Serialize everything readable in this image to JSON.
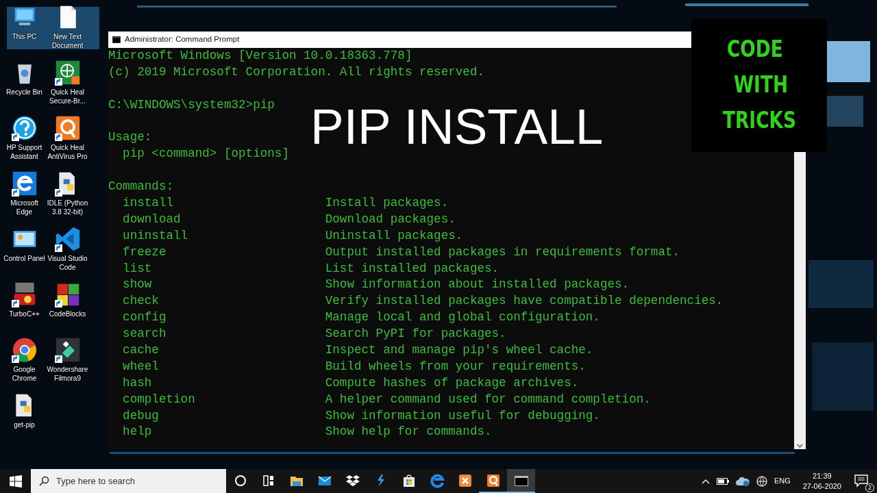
{
  "desktop_icons": [
    {
      "label": "This PC",
      "kind": "thispc",
      "shortcut": false
    },
    {
      "label": "New Text Document",
      "kind": "textdoc",
      "shortcut": false
    },
    {
      "label": "Recycle Bin",
      "kind": "recycle",
      "shortcut": false
    },
    {
      "label": "Quick Heal Secure-Br...",
      "kind": "qhbrowser",
      "shortcut": true
    },
    {
      "label": "HP Support Assistant",
      "kind": "hp",
      "shortcut": true
    },
    {
      "label": "Quick Heal AntiVirus Pro",
      "kind": "quickheal",
      "shortcut": true
    },
    {
      "label": "Microsoft Edge",
      "kind": "edge",
      "shortcut": true
    },
    {
      "label": "IDLE (Python 3.8 32-bit)",
      "kind": "python",
      "shortcut": true
    },
    {
      "label": "Control Panel",
      "kind": "controlpanel",
      "shortcut": false
    },
    {
      "label": "Visual Studio Code",
      "kind": "vscode",
      "shortcut": true
    },
    {
      "label": "TurboC++",
      "kind": "turbo",
      "shortcut": true
    },
    {
      "label": "CodeBlocks",
      "kind": "codeblocks",
      "shortcut": true
    },
    {
      "label": "Google Chrome",
      "kind": "chrome",
      "shortcut": true
    },
    {
      "label": "Wondershare Filmora9",
      "kind": "filmora",
      "shortcut": true
    },
    {
      "label": "get-pip",
      "kind": "python",
      "shortcut": false
    }
  ],
  "window": {
    "title": "Administrator: Command Prompt",
    "banner": [
      "Microsoft Windows [Version 10.0.18363.778]",
      "(c) 2019 Microsoft Corporation. All rights reserved."
    ],
    "prompt": "C:\\WINDOWS\\system32>pip",
    "usage_heading": "Usage:",
    "usage": "pip <command> [options]",
    "commands_heading": "Commands:",
    "commands": [
      {
        "name": "install",
        "description": "Install packages."
      },
      {
        "name": "download",
        "description": "Download packages."
      },
      {
        "name": "uninstall",
        "description": "Uninstall packages."
      },
      {
        "name": "freeze",
        "description": "Output installed packages in requirements format."
      },
      {
        "name": "list",
        "description": "List installed packages."
      },
      {
        "name": "show",
        "description": "Show information about installed packages."
      },
      {
        "name": "check",
        "description": "Verify installed packages have compatible dependencies."
      },
      {
        "name": "config",
        "description": "Manage local and global configuration."
      },
      {
        "name": "search",
        "description": "Search PyPI for packages."
      },
      {
        "name": "cache",
        "description": "Inspect and manage pip's wheel cache."
      },
      {
        "name": "wheel",
        "description": "Build wheels from your requirements."
      },
      {
        "name": "hash",
        "description": "Compute hashes of package archives."
      },
      {
        "name": "completion",
        "description": "A helper command used for command completion."
      },
      {
        "name": "debug",
        "description": "Show information useful for debugging."
      },
      {
        "name": "help",
        "description": "Show help for commands."
      }
    ]
  },
  "overlay_title": "PIP INSTALL",
  "logo": {
    "lines": [
      "CODE",
      "WITH",
      "TRICKS"
    ]
  },
  "taskbar": {
    "search": {
      "placeholder": "Type here to search"
    },
    "apps": [
      {
        "kind": "cortana",
        "running": false,
        "selected": false
      },
      {
        "kind": "taskview",
        "running": false,
        "selected": false
      },
      {
        "kind": "explorer",
        "running": false,
        "selected": false
      },
      {
        "kind": "mail",
        "running": false,
        "selected": false
      },
      {
        "kind": "dropbox",
        "running": false,
        "selected": false
      },
      {
        "kind": "lightning",
        "running": false,
        "selected": false
      },
      {
        "kind": "store",
        "running": false,
        "selected": false
      },
      {
        "kind": "edge",
        "running": false,
        "selected": false
      },
      {
        "kind": "xampp",
        "running": false,
        "selected": false
      },
      {
        "kind": "quickheal",
        "running": true,
        "selected": false
      },
      {
        "kind": "cmd",
        "running": true,
        "selected": true
      }
    ],
    "language": "ENG",
    "time": "21:39",
    "date": "27-06-2020",
    "notifications": "2"
  }
}
